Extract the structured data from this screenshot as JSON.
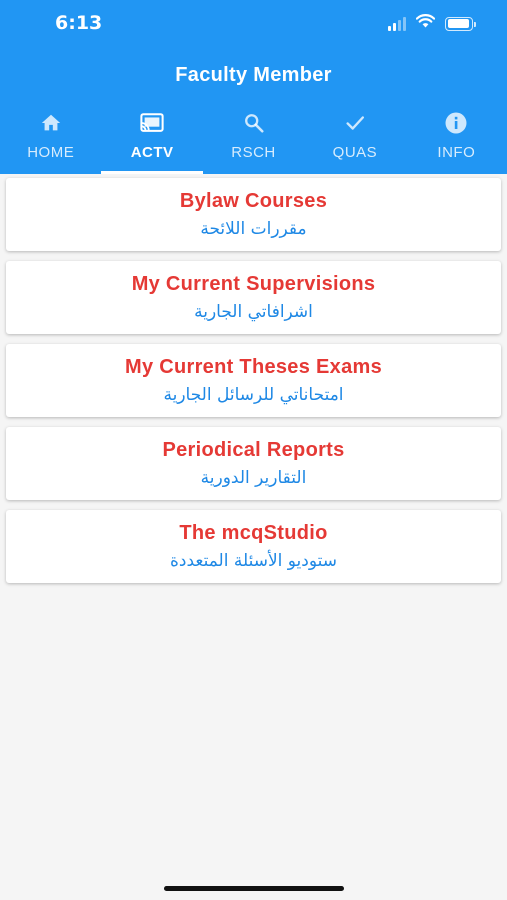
{
  "status_bar": {
    "time": "6:13",
    "signal_bars": 4,
    "signal_active": 2,
    "battery_level": 0.95
  },
  "app": {
    "title": "Faculty Member"
  },
  "tabs": [
    {
      "label": "HOME",
      "icon": "home-icon",
      "active": false
    },
    {
      "label": "ACTV",
      "icon": "cast-icon",
      "active": true
    },
    {
      "label": "RSCH",
      "icon": "search-icon",
      "active": false
    },
    {
      "label": "QUAS",
      "icon": "check-icon",
      "active": false
    },
    {
      "label": "INFO",
      "icon": "info-icon",
      "active": false
    }
  ],
  "items": [
    {
      "title": "Bylaw Courses",
      "subtitle": "مقررات اللائحة"
    },
    {
      "title": "My Current Supervisions",
      "subtitle": "اشرافاتي الجارية"
    },
    {
      "title": "My Current Theses Exams",
      "subtitle": "امتحاناتي للرسائل الجارية"
    },
    {
      "title": "Periodical Reports",
      "subtitle": "التقارير الدورية"
    },
    {
      "title": "The mcqStudio",
      "subtitle": "ستوديو الأسئلة المتعددة"
    }
  ],
  "colors": {
    "primary": "#2196f3",
    "item_title": "#e53935",
    "item_subtitle": "#1e88e5",
    "background": "#f5f5f5"
  }
}
